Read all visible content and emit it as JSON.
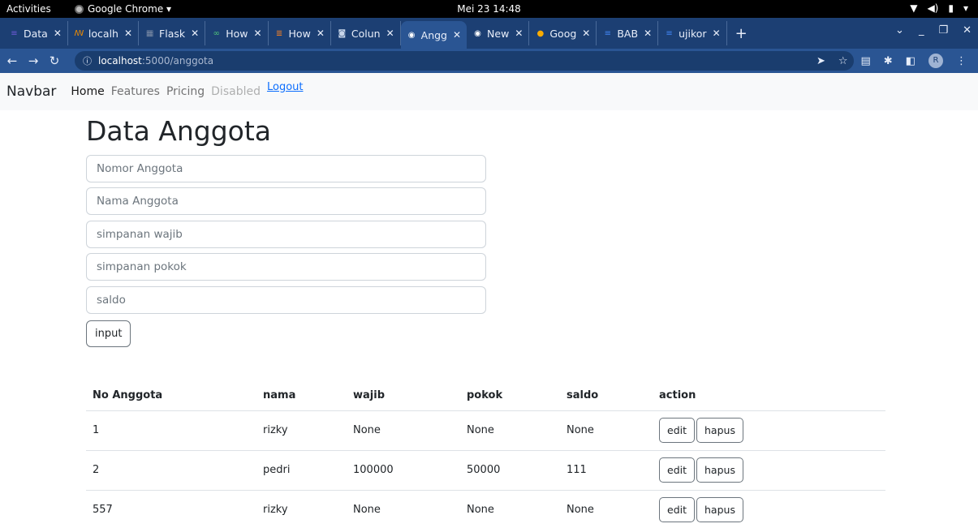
{
  "system": {
    "activities": "Activities",
    "app_name": "Google Chrome ▾",
    "clock": "Mei 23  14:48"
  },
  "browser": {
    "tabs": [
      {
        "label": "Data",
        "icon": "list-icon",
        "color": "#6f5bd9"
      },
      {
        "label": "localh",
        "icon": "xampp-icon",
        "color": "#f08c00"
      },
      {
        "label": "Flask",
        "icon": "table-icon",
        "color": "#7c8ca6"
      },
      {
        "label": "How",
        "icon": "link-icon",
        "color": "#4ec27a"
      },
      {
        "label": "How",
        "icon": "stackoverflow-icon",
        "color": "#f48024"
      },
      {
        "label": "Colun",
        "icon": "square-icon",
        "color": "#c9d6ea"
      },
      {
        "label": "Angg",
        "icon": "chrome-icon",
        "color": "#ffffff"
      },
      {
        "label": "New",
        "icon": "chrome-icon",
        "color": "#ffffff"
      },
      {
        "label": "Goog",
        "icon": "keep-icon",
        "color": "#f9ab00"
      },
      {
        "label": "BAB",
        "icon": "docs-icon",
        "color": "#4285f4"
      },
      {
        "label": "ujikor",
        "icon": "docs-icon",
        "color": "#4285f4"
      }
    ],
    "active_tab_index": 6,
    "url_host": "localhost",
    "url_path": ":5000/anggota",
    "avatar_letter": "R"
  },
  "navbar": {
    "brand": "Navbar",
    "links": [
      "Home",
      "Features",
      "Pricing",
      "Disabled"
    ],
    "logout": "Logout"
  },
  "form": {
    "title": "Data Anggota",
    "fields": [
      {
        "placeholder": "Nomor Anggota"
      },
      {
        "placeholder": "Nama Anggota"
      },
      {
        "placeholder": "simpanan wajib"
      },
      {
        "placeholder": "simpanan pokok"
      },
      {
        "placeholder": "saldo"
      }
    ],
    "submit": "input"
  },
  "table": {
    "headers": [
      "No Anggota",
      "nama",
      "wajib",
      "pokok",
      "saldo",
      "action"
    ],
    "rows": [
      {
        "no": "1",
        "nama": "rizky",
        "wajib": "None",
        "pokok": "None",
        "saldo": "None"
      },
      {
        "no": "2",
        "nama": "pedri",
        "wajib": "100000",
        "pokok": "50000",
        "saldo": "111"
      },
      {
        "no": "557",
        "nama": "rizky",
        "wajib": "None",
        "pokok": "None",
        "saldo": "None"
      }
    ],
    "edit_label": "edit",
    "delete_label": "hapus"
  }
}
